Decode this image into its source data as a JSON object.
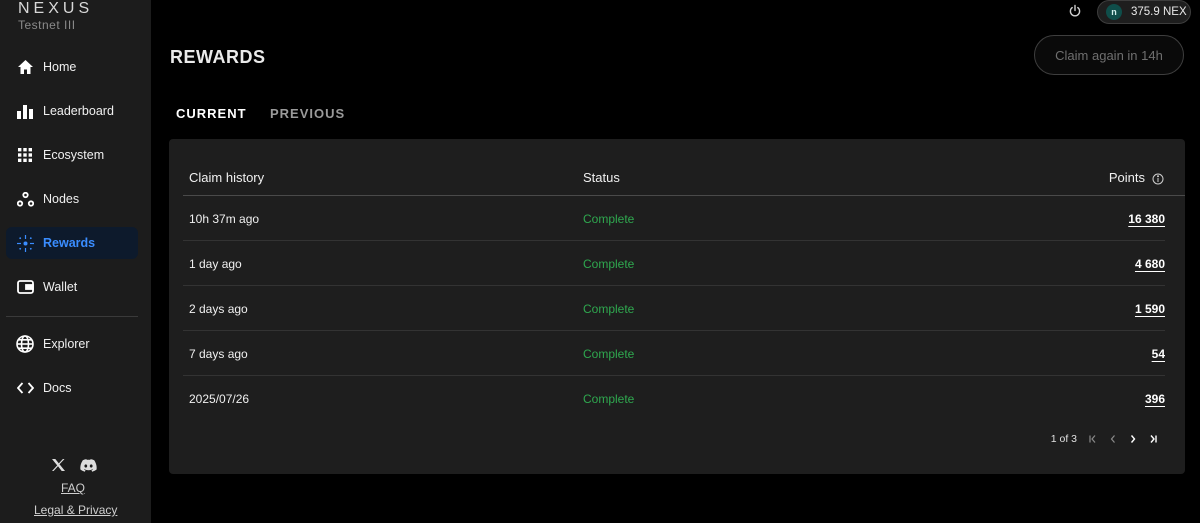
{
  "brand": {
    "name": "NEXUS",
    "subtitle": "Testnet III"
  },
  "nav": [
    {
      "label": "Home",
      "icon": "home-icon"
    },
    {
      "label": "Leaderboard",
      "icon": "bar-chart-icon"
    },
    {
      "label": "Ecosystem",
      "icon": "grid-icon"
    },
    {
      "label": "Nodes",
      "icon": "nodes-icon"
    },
    {
      "label": "Rewards",
      "icon": "rewards-sparkle-icon",
      "active": true
    },
    {
      "label": "Wallet",
      "icon": "wallet-icon"
    },
    {
      "label": "Explorer",
      "icon": "globe-icon"
    },
    {
      "label": "Docs",
      "icon": "code-icon"
    }
  ],
  "footer": {
    "faq": "FAQ",
    "legal": "Legal & Privacy",
    "social": [
      "x-icon",
      "discord-icon"
    ]
  },
  "header": {
    "balance": "375.9 NEX",
    "coin_letter": "n",
    "title": "REWARDS",
    "claim_button": "Claim again in 14h"
  },
  "tabs": {
    "current": "CURRENT",
    "previous": "PREVIOUS"
  },
  "table": {
    "headers": {
      "history": "Claim history",
      "status": "Status",
      "points": "Points"
    },
    "rows": [
      {
        "time": "10h 37m ago",
        "status": "Complete",
        "points": "16 380"
      },
      {
        "time": "1 day ago",
        "status": "Complete",
        "points": "4 680"
      },
      {
        "time": "2 days ago",
        "status": "Complete",
        "points": "1 590"
      },
      {
        "time": "7 days ago",
        "status": "Complete",
        "points": "54"
      },
      {
        "time": "2025/07/26",
        "status": "Complete",
        "points": "396"
      }
    ],
    "pagination": "1 of 3"
  },
  "colors": {
    "accent": "#3a8dff",
    "status_complete": "#2fa84f",
    "sidebar_bg": "#1c1c1c",
    "panel_bg": "#1e1e1e"
  }
}
